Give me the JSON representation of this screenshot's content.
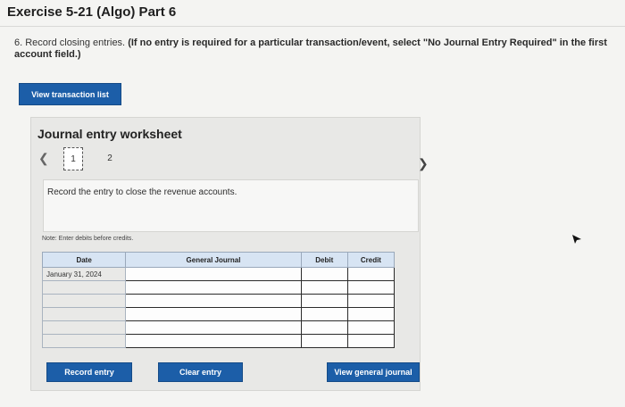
{
  "header": {
    "title": "Exercise 5-21 (Algo) Part 6"
  },
  "question": {
    "text": "6. Record closing entries.",
    "instruction": "(If no entry is required for a particular transaction/event, select \"No Journal Entry Required\" in the first account field.)"
  },
  "buttons": {
    "view_transaction_list": "View transaction list",
    "record_entry": "Record entry",
    "clear_entry": "Clear entry",
    "view_general_journal": "View general journal"
  },
  "worksheet": {
    "title": "Journal entry worksheet",
    "pages": [
      "1",
      "2"
    ],
    "current_page": "1",
    "description": "Record the entry to close the revenue accounts.",
    "note": "Note: Enter debits before credits."
  },
  "table": {
    "columns": [
      "Date",
      "General Journal",
      "Debit",
      "Credit"
    ],
    "rows": [
      {
        "date": "January 31, 2024",
        "account": "",
        "debit": "",
        "credit": ""
      },
      {
        "date": "",
        "account": "",
        "debit": "",
        "credit": ""
      },
      {
        "date": "",
        "account": "",
        "debit": "",
        "credit": ""
      },
      {
        "date": "",
        "account": "",
        "debit": "",
        "credit": ""
      },
      {
        "date": "",
        "account": "",
        "debit": "",
        "credit": ""
      },
      {
        "date": "",
        "account": "",
        "debit": "",
        "credit": ""
      }
    ]
  },
  "icons": {
    "prev": "chevron-left-icon",
    "next": "chevron-right-icon",
    "cursor": "mouse-cursor-icon"
  }
}
